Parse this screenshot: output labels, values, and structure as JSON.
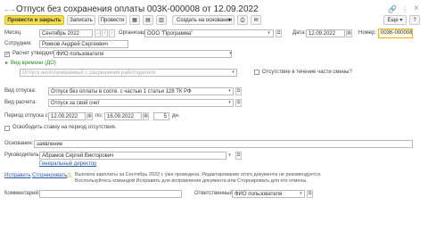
{
  "window": {
    "title": "Отпуск без сохранения оплаты 003К-000008 от 12.09.2022",
    "star": "☆",
    "link_icon": "link-icon",
    "more_icon": "⋮",
    "close_icon": "×"
  },
  "toolbar": {
    "post_close": "Провести и закрыть",
    "save": "Записать",
    "post": "Провести",
    "create_based": "Создать на основании",
    "more": "Еще",
    "help": "?"
  },
  "form": {
    "month_label": "Месяц:",
    "month_value": "Сентябрь 2022",
    "org_label": "Организация:",
    "org_value": "ООО \"Программа\"",
    "date_label": "Дата:",
    "date_value": "12.09.2022",
    "number_label": "Номер:",
    "number_value": "003К-000008",
    "employee_label": "Сотрудник:",
    "employee_value": "Рожков Андрей Сергеевич",
    "calc_approved_label": "Расчет утвердил:",
    "calc_approved_value": "ФИО пользователя",
    "time_type_label": "Вид времени (ДО)",
    "time_type_placeholder": "Отпуск неоплачиваемый с разрешения работодателя",
    "absence_part_label": "Отсутствие в течение части смены?",
    "leave_type_label": "Вид отпуска:",
    "leave_type_value": "Отпуск без оплаты в соотв. с частью 1 статьи 128 ТК РФ",
    "calc_type_label": "Вид расчета:",
    "calc_type_value": "Отпуск за свой счет",
    "period_label": "Период отпуска с:",
    "period_from": "12.09.2022",
    "period_to_label": "по:",
    "period_to": "16.09.2022",
    "days_value": "5",
    "days_unit": "дн.",
    "free_rate_label": "Освободить ставку на период отсутствия.",
    "basis_label": "Основание:",
    "basis_value": "заявление",
    "head_label": "Руководитель:",
    "head_value": "Абрамов Сергей Викторович",
    "head_position": "Генеральный директор",
    "fix_link": "Исправить",
    "reverse_link": "Сторнировать",
    "warning_text": "Выплата зарплаты за Сентябрь 2022 г. уже проведена. Редактирование этого документа не рекомендуется. Воспользуйтесь командой Исправить для исправления документа или Сторнировать для его отмены.",
    "comment_label": "Комментарий:",
    "comment_value": "",
    "responsible_label": "Ответственный:",
    "responsible_value": "ФИО пользователя"
  }
}
